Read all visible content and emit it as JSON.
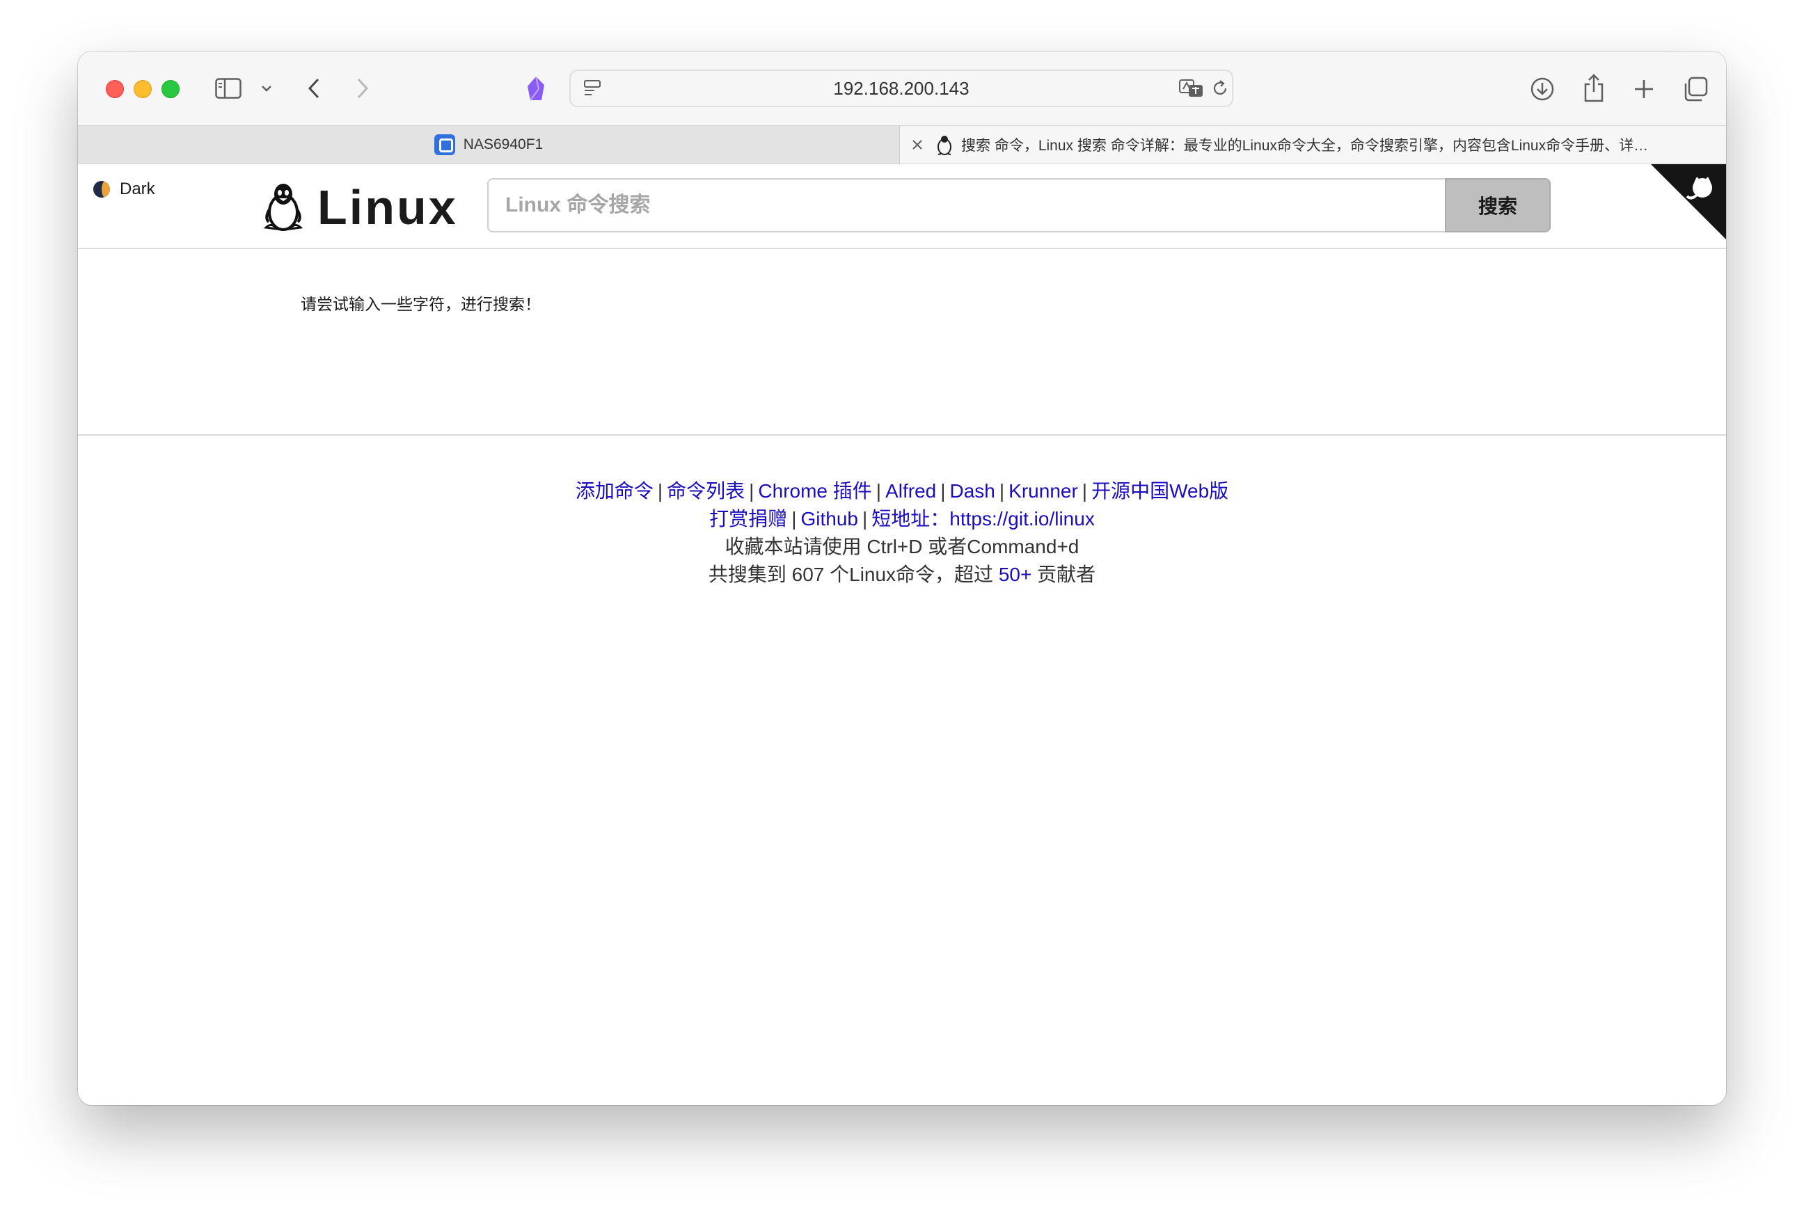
{
  "browser": {
    "address": "192.168.200.143",
    "tabs": [
      {
        "label": "NAS6940F1",
        "active": false
      },
      {
        "label": "搜索 命令，Linux 搜索 命令详解：最专业的Linux命令大全，命令搜索引擎，内容包含Linux命令手册、详…",
        "active": true
      }
    ]
  },
  "header": {
    "dark_label": "Dark",
    "logo_text": "Linux",
    "search_placeholder": "Linux 命令搜索",
    "search_button": "搜索"
  },
  "main": {
    "hint": "请尝试输入一些字符，进行搜索！"
  },
  "footer": {
    "links_row1": [
      "添加命令",
      "命令列表",
      "Chrome 插件",
      "Alfred",
      "Dash",
      "Krunner",
      "开源中国Web版"
    ],
    "links_row2": [
      "打赏捐赠",
      "Github"
    ],
    "short_label": "短地址：",
    "short_url": "https://git.io/linux",
    "bookmark_text": "收藏本站请使用 Ctrl+D 或者Command+d",
    "count_prefix": "共搜集到 607 个Linux命令，超过",
    "contributors": "50+",
    "count_suffix": "贡献者"
  },
  "colors": {
    "link": "#1a0dbf",
    "search_button_bg": "#bebebe"
  }
}
